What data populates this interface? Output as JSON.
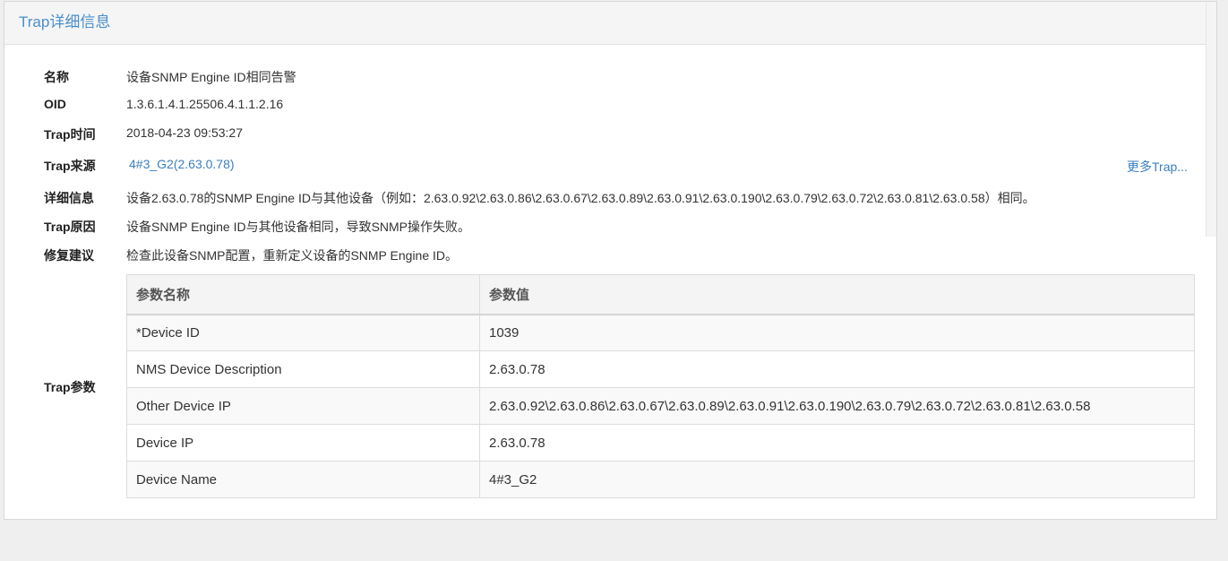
{
  "panel": {
    "title": "Trap详细信息"
  },
  "fields": [
    {
      "label": "名称",
      "value": "设备SNMP Engine ID相同告警"
    },
    {
      "label": "OID",
      "value": "1.3.6.1.4.1.25506.4.1.1.2.16"
    },
    {
      "label": "Trap时间",
      "value": "2018-04-23 09:53:27"
    },
    {
      "label": "Trap来源",
      "value": "4#3_G2(2.63.0.78)"
    },
    {
      "label": "详细信息",
      "value": "设备2.63.0.78的SNMP Engine ID与其他设备（例如：2.63.0.92\\2.63.0.86\\2.63.0.67\\2.63.0.89\\2.63.0.91\\2.63.0.190\\2.63.0.79\\2.63.0.72\\2.63.0.81\\2.63.0.58）相同。"
    },
    {
      "label": "Trap原因",
      "value": "设备SNMP Engine ID与其他设备相同，导致SNMP操作失败。"
    },
    {
      "label": "修复建议",
      "value": "检查此设备SNMP配置，重新定义设备的SNMP Engine ID。"
    }
  ],
  "more_link": "更多Trap...",
  "params": {
    "label": "Trap参数",
    "headers": [
      "参数名称",
      "参数值"
    ],
    "rows": [
      [
        "*Device ID",
        "1039"
      ],
      [
        "NMS Device Description",
        "2.63.0.78"
      ],
      [
        "Other Device IP",
        "2.63.0.92\\2.63.0.86\\2.63.0.67\\2.63.0.89\\2.63.0.91\\2.63.0.190\\2.63.0.79\\2.63.0.72\\2.63.0.81\\2.63.0.58"
      ],
      [
        "Device IP",
        "2.63.0.78"
      ],
      [
        "Device Name",
        "4#3_G2"
      ]
    ]
  }
}
